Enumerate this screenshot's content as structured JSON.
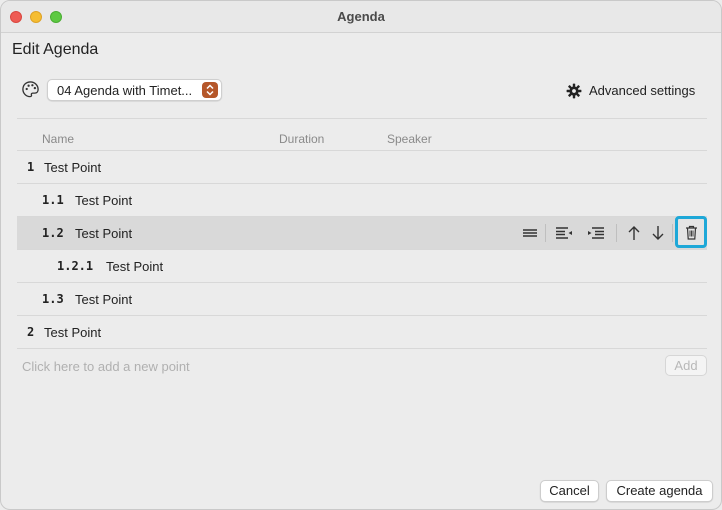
{
  "window": {
    "title": "Agenda"
  },
  "page": {
    "heading": "Edit Agenda"
  },
  "toolbar": {
    "palette_icon": "palette-icon",
    "template_value": "04 Agenda with Timet...",
    "advanced_settings_label": "Advanced settings",
    "advanced_settings_icon": "gear-icon"
  },
  "columns": {
    "name": "Name",
    "duration": "Duration",
    "speaker": "Speaker"
  },
  "agenda_items": [
    {
      "number": "1",
      "label": "Test Point",
      "level": 1,
      "selected": false
    },
    {
      "number": "1.1",
      "label": "Test Point",
      "level": 2,
      "selected": false
    },
    {
      "number": "1.2",
      "label": "Test Point",
      "level": 2,
      "selected": true
    },
    {
      "number": "1.2.1",
      "label": "Test Point",
      "level": 3,
      "selected": false
    },
    {
      "number": "1.3",
      "label": "Test Point",
      "level": 2,
      "selected": false
    },
    {
      "number": "2",
      "label": "Test Point",
      "level": 1,
      "selected": false
    }
  ],
  "row_actions": [
    "drag-handle-icon",
    "outdent-icon",
    "indent-icon",
    "move-up-icon",
    "move-down-icon",
    "trash-icon"
  ],
  "add_point": {
    "placeholder": "Click here to add a new point",
    "button_label": "Add"
  },
  "footer": {
    "cancel_label": "Cancel",
    "create_label": "Create agenda"
  },
  "colors": {
    "highlight": "#1ea8d8",
    "selected_row": "#d9d9d9",
    "template_stepper": "#b5572a"
  }
}
